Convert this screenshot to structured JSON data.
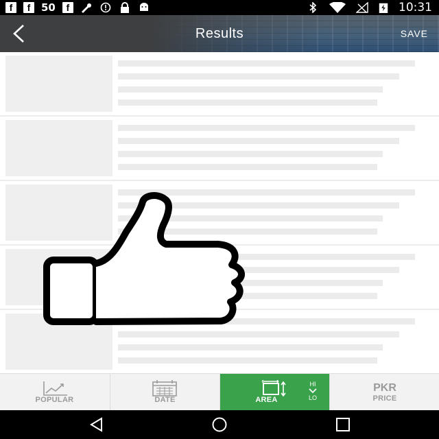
{
  "status_bar": {
    "signal_text": "50",
    "fb_glyph": "f",
    "time": "10:31",
    "icons": [
      "facebook-icon",
      "facebook-icon",
      "facebook-icon",
      "fav-icon",
      "alarm-icon",
      "lock-icon",
      "android-icon",
      "bluetooth-icon",
      "wifi-icon",
      "no-signal-icon",
      "battery-icon"
    ]
  },
  "header": {
    "title": "Results",
    "save_label": "SAVE",
    "back_icon": "back-arrow-icon"
  },
  "overlay": {
    "icon": "thumbs-up-icon"
  },
  "sort_bar": {
    "popular_label": "POPULAR",
    "date_label": "DATE",
    "area_label": "AREA",
    "area_hi": "HI",
    "area_lo": "LO",
    "price_currency": "PKR",
    "price_label": "PRICE",
    "active_tab": "AREA",
    "active_color": "#3aa24a"
  },
  "nav_bar": {
    "icons": [
      "back-triangle-icon",
      "home-circle-icon",
      "recents-square-icon"
    ]
  }
}
